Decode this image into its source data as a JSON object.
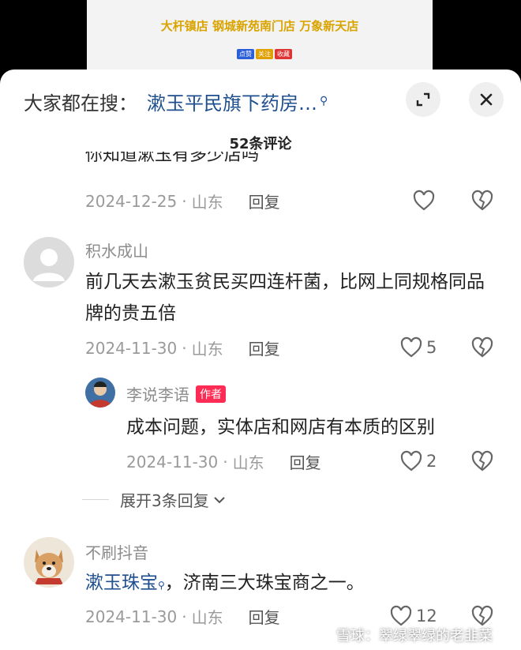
{
  "video": {
    "banner": "大杆镇店 钢城新苑南门店 万象新天店",
    "badges": [
      "点赞",
      "关注",
      "收藏"
    ]
  },
  "search": {
    "prefix": "大家都在搜：",
    "term": "漱玉平民旗下药房…"
  },
  "comments_header": {
    "count_label": "52条评论"
  },
  "comments": [
    {
      "clipped_text": "你知道漱玉有多少店吗",
      "date": "2024-12-25",
      "location": "山东",
      "reply_label": "回复",
      "likes": ""
    },
    {
      "user": "积水成山",
      "text": "前几天去漱玉贫民买四连杆菌，比网上同规格同品牌的贵五倍",
      "date": "2024-11-30",
      "location": "山东",
      "reply_label": "回复",
      "likes": "5"
    },
    {
      "user": "李说李语",
      "badge": "作者",
      "text": "成本问题，实体店和网店有本质的区别",
      "date": "2024-11-30",
      "location": "山东",
      "reply_label": "回复",
      "likes": "2"
    },
    {
      "user": "不刷抖音",
      "link_term": "漱玉珠宝",
      "text": "，济南三大珠宝商之一。",
      "date": "2024-11-30",
      "location": "山东",
      "reply_label": "回复",
      "likes": "12"
    }
  ],
  "expand": {
    "label": "展开3条回复"
  },
  "watermark": {
    "text": "雪球：翠绿翠绿的老韭菜"
  },
  "colors": {
    "link": "#1f4f8f",
    "author_badge": "#fe2c55",
    "meta": "#9a9a9a"
  }
}
